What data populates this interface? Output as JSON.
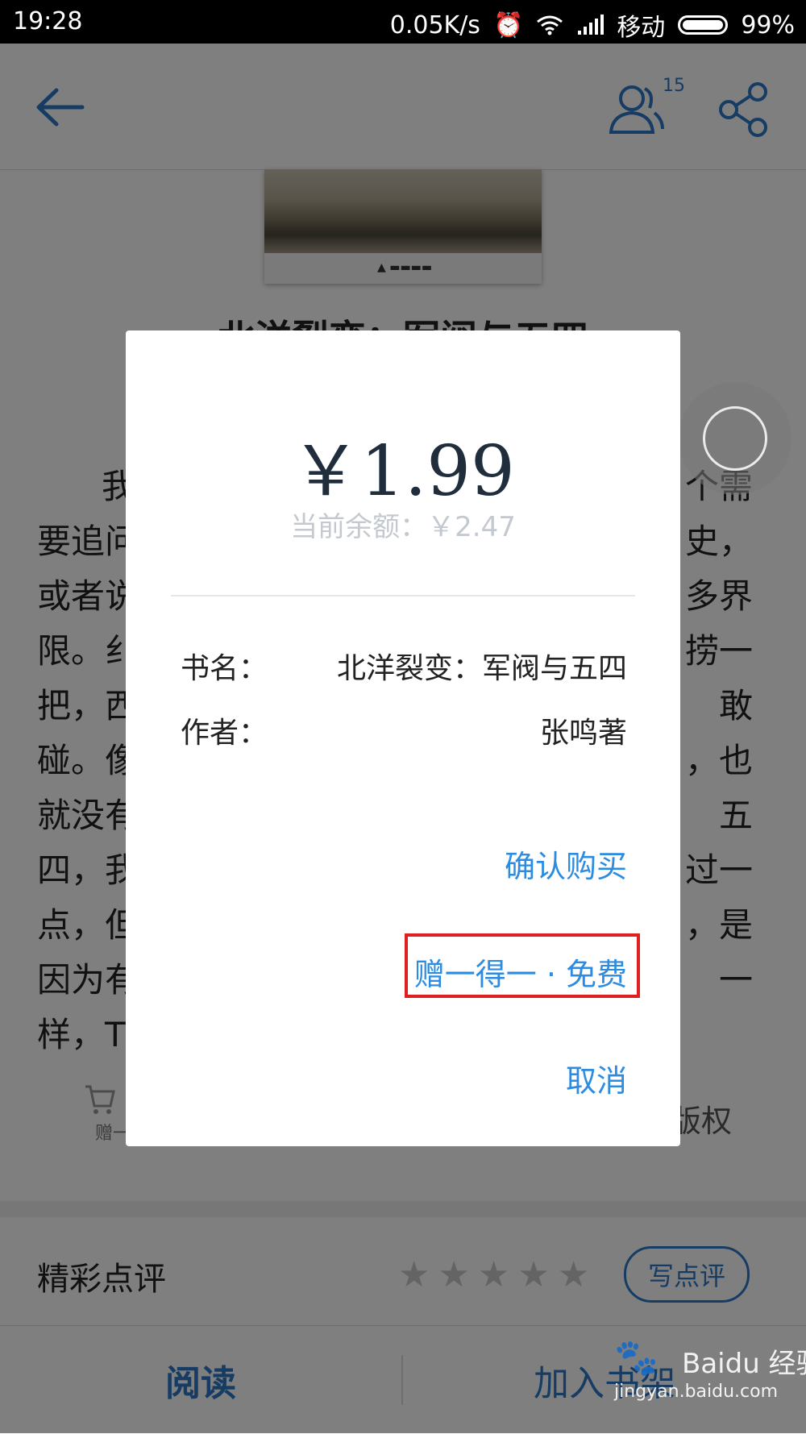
{
  "status_bar": {
    "time": "19:28",
    "network_speed": "0.05K/s",
    "carrier": "移动",
    "battery": "99%"
  },
  "header": {
    "users_count": "15"
  },
  "book": {
    "title_partial": "北洋裂变：军阀与五四",
    "body_lines": [
      {
        "left": "我",
        "right": "个需"
      },
      {
        "left": "要追问",
        "right": "史，"
      },
      {
        "left": "或者说",
        "right": "多界"
      },
      {
        "left": "限。纟",
        "right": "捞一"
      },
      {
        "left": "把，西",
        "right": "敢"
      },
      {
        "left": "碰。像",
        "right": "，也"
      },
      {
        "left": "就没有",
        "right": "五"
      },
      {
        "left": "四，我",
        "right": "过一"
      },
      {
        "left": "点，但",
        "right": "，是"
      },
      {
        "left": "因为有",
        "right": "一"
      },
      {
        "left": "样，T",
        "right": ""
      }
    ],
    "cart_label": "赠一",
    "copyright_label": "版权"
  },
  "review": {
    "label": "精彩点评",
    "stars": [
      "★",
      "★",
      "★",
      "★",
      "★"
    ],
    "write_button": "写点评"
  },
  "bottom_bar": {
    "read": "阅读",
    "add_to_shelf": "加入书架"
  },
  "dialog": {
    "price": "￥1.99",
    "balance": "当前余额：￥2.47",
    "book_name_label": "书名：",
    "book_name_value": "北洋裂变：军阀与五四",
    "author_label": "作者：",
    "author_value": "张鸣著",
    "confirm": "确认购买",
    "gift": "赠一得一 · 免费",
    "cancel": "取消"
  },
  "watermark": {
    "cn": "Baidu 经验",
    "en": "jingyan.baidu.com"
  },
  "colors": {
    "accent": "#2d8ce0",
    "highlight_box": "#e02020"
  }
}
